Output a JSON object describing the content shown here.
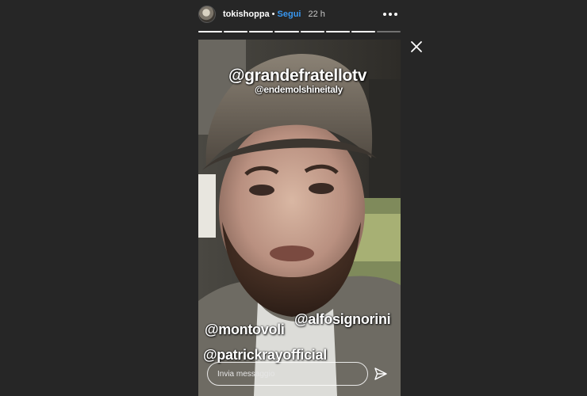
{
  "header": {
    "username": "tokishoppa",
    "separator": "•",
    "follow_label": "Segui",
    "time": "22 h",
    "more_icon": "more-horizontal-icon"
  },
  "progress": {
    "segments": 8,
    "completed": 7
  },
  "close_icon": "close-icon",
  "story": {
    "tags": [
      "@grandefratellotv",
      "@endemolshineitaly",
      "@montovoli",
      "@alfosignorini",
      "@patrickrayofficial"
    ],
    "message_placeholder": "Invia messaggio",
    "send_icon": "send-icon"
  },
  "colors": {
    "background": "#262626",
    "follow": "#3897f0"
  }
}
